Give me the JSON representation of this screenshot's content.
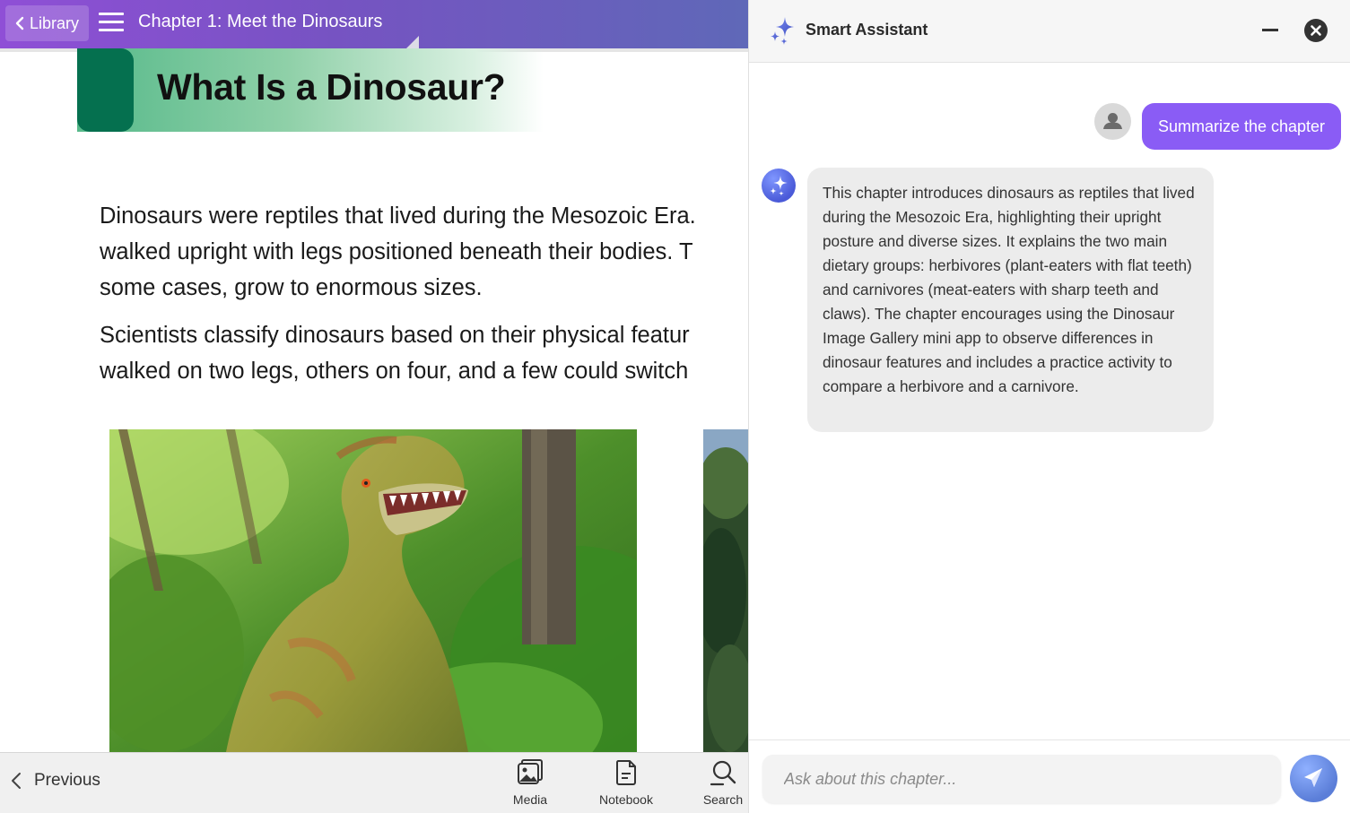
{
  "reader": {
    "back_label": "Library",
    "chapter_title": "Chapter 1: Meet the Dinosaurs",
    "section_heading": "What Is a Dinosaur?",
    "paragraphs": [
      {
        "lines": [
          "Dinosaurs were reptiles that lived during the Mesozoic Era. ",
          "walked upright with legs positioned beneath their bodies. T",
          "some cases, grow to enormous sizes."
        ]
      },
      {
        "lines": [
          "Scientists classify dinosaurs based on their physical featur",
          "walked on two legs, others on four, and a few could switch"
        ]
      }
    ],
    "toolbar": {
      "previous_label": "Previous",
      "media_label": "Media",
      "notebook_label": "Notebook",
      "search_label": "Search"
    }
  },
  "assistant": {
    "title": "Smart Assistant",
    "user_message": "Summarize the chapter",
    "bot_message": "This chapter introduces dinosaurs as reptiles that lived during the Mesozoic Era, highlighting their upright posture and diverse sizes. It explains the two main dietary groups: herbivores (plant-eaters with flat teeth) and carnivores (meat-eaters with sharp teeth and claws). The chapter encourages using the Dinosaur Image Gallery mini app to observe differences in dinosaur features and includes a practice activity to compare a herbivore and a carnivore.",
    "input_placeholder": "Ask about this chapter...",
    "input_value": ""
  },
  "colors": {
    "topbar_start": "#8f4fd6",
    "topbar_end": "#5f68b8",
    "heading_tab": "#05704f",
    "user_bubble": "#8a5cf5",
    "bot_bubble": "#ececec",
    "send_button": "#5b7ed8"
  },
  "icons": {
    "back": "chevron-left-icon",
    "menu": "hamburger-menu-icon",
    "assistant_logo": "sparkles-icon",
    "minimize": "minimize-icon",
    "close": "close-circle-icon",
    "user": "user-avatar-icon",
    "bot": "sparkles-icon",
    "send": "paper-plane-icon",
    "media": "image-gallery-icon",
    "notebook": "document-icon",
    "search": "search-icon",
    "previous": "chevron-left-icon"
  }
}
